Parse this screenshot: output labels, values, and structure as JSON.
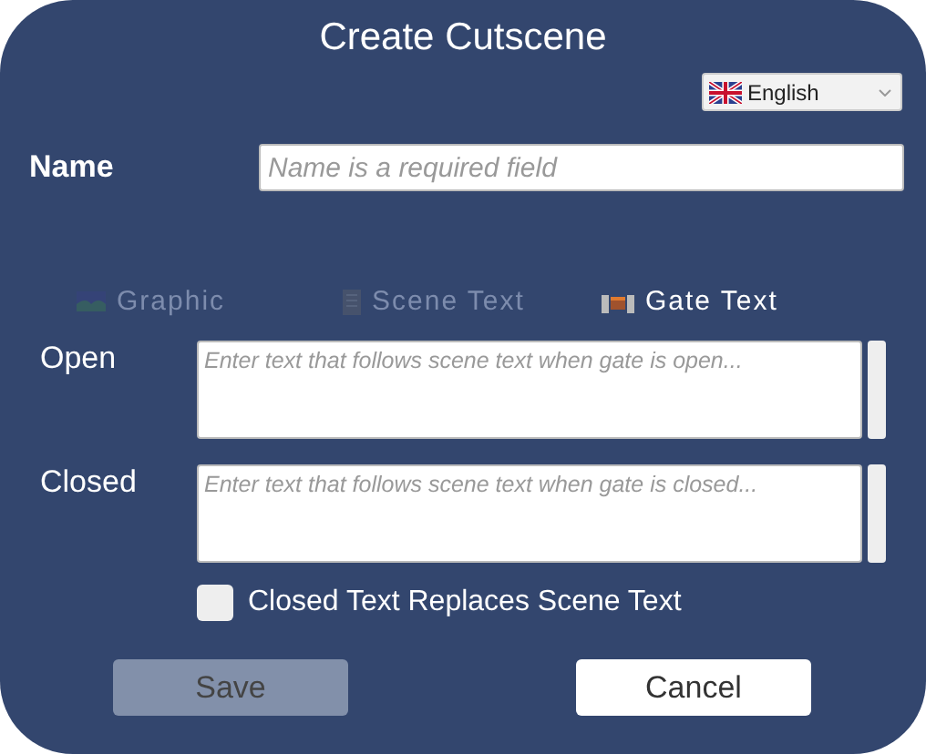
{
  "dialog": {
    "title": "Create Cutscene"
  },
  "language": {
    "value": "English"
  },
  "name_field": {
    "label": "Name",
    "placeholder": "Name is a required field"
  },
  "tabs": [
    {
      "label": "Graphic",
      "kind": "graphic",
      "selected": false
    },
    {
      "label": "Scene Text",
      "kind": "scene",
      "selected": false
    },
    {
      "label": "Gate Text",
      "kind": "gate",
      "selected": true
    }
  ],
  "text_fields": [
    {
      "label": "Open",
      "placeholder": "Enter text that follows scene text when gate is open..."
    },
    {
      "label": "Closed",
      "placeholder": "Enter text that follows scene text when gate is closed..."
    }
  ],
  "checkbox": {
    "label": "Closed Text Replaces Scene Text",
    "checked": false
  },
  "buttons": [
    {
      "label": "Save",
      "disabled": true
    },
    {
      "label": "Cancel",
      "disabled": false
    }
  ]
}
